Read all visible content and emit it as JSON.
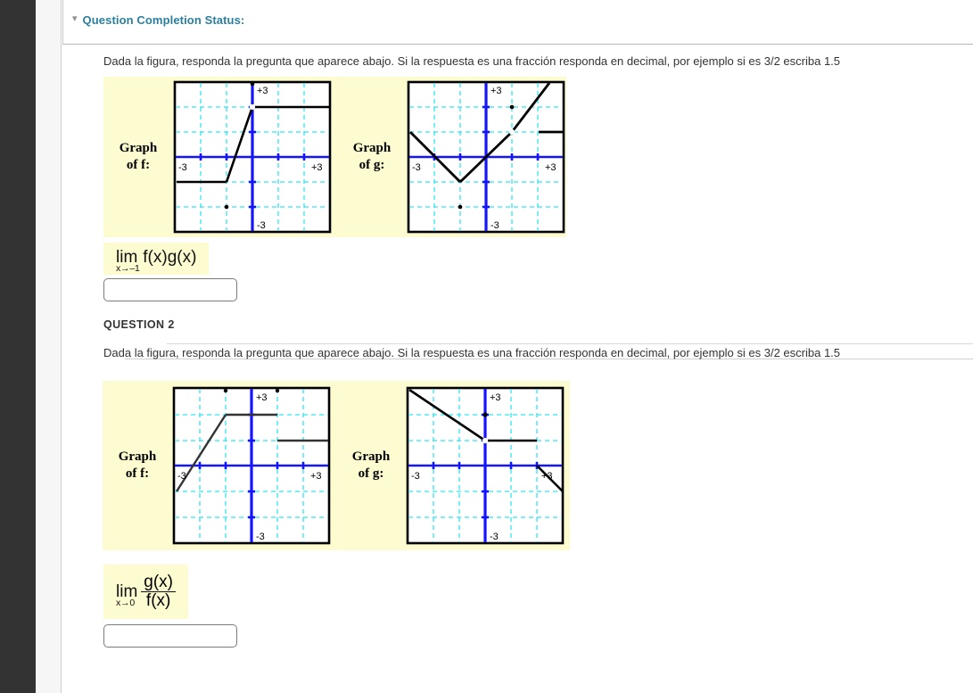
{
  "sidebar": {
    "rail_color": "#333333",
    "strip_color": "#f6f6f6"
  },
  "status_bar": {
    "caret_icon": "chevron-down-icon",
    "title": "Question Completion Status:"
  },
  "questions": [
    {
      "id": "q1",
      "label": "",
      "prompt": "Dada la figura, responda la pregunta que aparece abajo. Si la respuesta es una fracción responda en decimal, por ejemplo si es 3/2 escriba 1.5",
      "figure": {
        "background": "#fdfbd0",
        "f_label_line1": "Graph",
        "f_label_line2": "of f:",
        "g_label_line1": "Graph",
        "g_label_line2": "of g:",
        "axis_left_label": "-3",
        "axis_right_label": "+3",
        "axis_top_label": "+3",
        "axis_bottom_label": "-3"
      },
      "limit": {
        "op": "lim",
        "sub": "x→–1",
        "body": "f(x)g(x)",
        "is_fraction": false,
        "numerator": "",
        "denominator": ""
      },
      "answer_value": "",
      "answer_placeholder": ""
    },
    {
      "id": "q2",
      "label": "QUESTION 2",
      "prompt": "Dada la figura, responda la pregunta que aparece abajo. Si la respuesta es una fracción responda en decimal, por ejemplo si es 3/2 escriba 1.5",
      "figure": {
        "background": "#fdfbd0",
        "f_label_line1": "Graph",
        "f_label_line2": "of f:",
        "g_label_line1": "Graph",
        "g_label_line2": "of g:",
        "axis_left_label": "-3",
        "axis_right_label": "+3",
        "axis_top_label": "+3",
        "axis_bottom_label": "-3"
      },
      "limit": {
        "op": "lim",
        "sub": "x→0",
        "body": "",
        "is_fraction": true,
        "numerator": "g(x)",
        "denominator": "f(x)"
      },
      "answer_value": "",
      "answer_placeholder": ""
    }
  ],
  "chart_data": [
    {
      "id": "q1-graph-f",
      "type": "line",
      "title": "Graph of f:",
      "xlim": [
        -3,
        3
      ],
      "ylim": [
        -3,
        3
      ],
      "grid": true,
      "xlabel": "",
      "ylabel": "",
      "tick_labels": {
        "left": "-3",
        "right": "+3",
        "top": "+3",
        "bottom": "-3"
      },
      "segments": [
        {
          "points": [
            [
              -3,
              -1
            ],
            [
              -1,
              -1
            ]
          ],
          "style": "solid"
        },
        {
          "points": [
            [
              -1,
              -1
            ],
            [
              0,
              2
            ]
          ],
          "style": "solid"
        },
        {
          "points": [
            [
              0,
              2
            ],
            [
              3,
              2
            ]
          ],
          "style": "solid"
        }
      ],
      "open_points": [
        [
          0,
          2
        ]
      ],
      "closed_points": [
        [
          0,
          3
        ],
        [
          -1,
          -2
        ]
      ]
    },
    {
      "id": "q1-graph-g",
      "type": "line",
      "title": "Graph of g:",
      "xlim": [
        -3,
        3
      ],
      "ylim": [
        -3,
        3
      ],
      "grid": true,
      "xlabel": "",
      "ylabel": "",
      "tick_labels": {
        "left": "-3",
        "right": "+3",
        "top": "+3",
        "bottom": "-3"
      },
      "segments": [
        {
          "points": [
            [
              -3,
              1
            ],
            [
              -1,
              -1
            ]
          ],
          "style": "solid"
        },
        {
          "points": [
            [
              -1,
              -1
            ],
            [
              1,
              1
            ]
          ],
          "style": "solid"
        },
        {
          "points": [
            [
              1,
              1
            ],
            [
              3,
              3
            ]
          ],
          "style": "solid"
        },
        {
          "points": [
            [
              2.4,
              1
            ],
            [
              3,
              1
            ]
          ],
          "style": "solid"
        }
      ],
      "open_points": [
        [
          1,
          1
        ]
      ],
      "closed_points": [
        [
          1,
          2
        ],
        [
          -1,
          -2
        ]
      ]
    },
    {
      "id": "q2-graph-f",
      "type": "line",
      "title": "Graph of f:",
      "xlim": [
        -3,
        3
      ],
      "ylim": [
        -3,
        3
      ],
      "grid": true,
      "xlabel": "",
      "ylabel": "",
      "tick_labels": {
        "left": "-3",
        "right": "+3",
        "top": "+3",
        "bottom": "-3"
      },
      "segments": [
        {
          "points": [
            [
              -3,
              -1
            ],
            [
              -1,
              2
            ]
          ],
          "style": "solid"
        },
        {
          "points": [
            [
              -1,
              2
            ],
            [
              1,
              2
            ]
          ],
          "style": "solid"
        },
        {
          "points": [
            [
              1,
              1
            ],
            [
              3,
              1
            ]
          ],
          "style": "solid"
        }
      ],
      "open_points": [],
      "closed_points": [
        [
          -1,
          3
        ],
        [
          1,
          3
        ]
      ]
    },
    {
      "id": "q2-graph-g",
      "type": "line",
      "title": "Graph of g:",
      "xlim": [
        -3,
        3
      ],
      "ylim": [
        -3,
        3
      ],
      "grid": true,
      "xlabel": "",
      "ylabel": "",
      "tick_labels": {
        "left": "-3",
        "right": "+3",
        "top": "+3",
        "bottom": "-3"
      },
      "segments": [
        {
          "points": [
            [
              -3,
              3
            ],
            [
              0,
              1
            ]
          ],
          "style": "solid"
        },
        {
          "points": [
            [
              0,
              1
            ],
            [
              2,
              1
            ]
          ],
          "style": "solid"
        },
        {
          "points": [
            [
              2,
              0
            ],
            [
              3,
              -1
            ]
          ],
          "style": "solid"
        }
      ],
      "open_points": [
        [
          0,
          1
        ]
      ],
      "closed_points": [
        [
          0,
          2
        ]
      ]
    }
  ]
}
